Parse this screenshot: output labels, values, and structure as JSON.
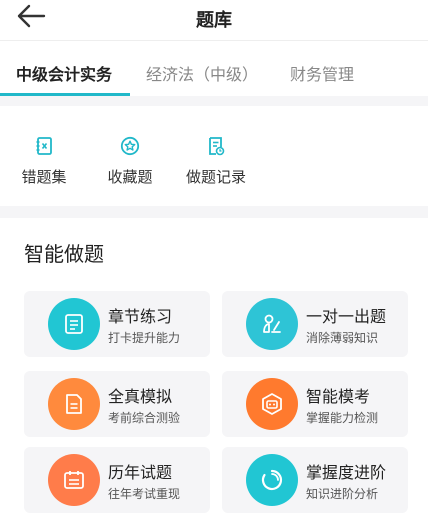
{
  "header": {
    "title": "题库",
    "back_icon": "arrow-left-icon"
  },
  "tabs": [
    {
      "label": "中级会计实务",
      "active": true
    },
    {
      "label": "经济法（中级）",
      "active": false
    },
    {
      "label": "财务管理",
      "active": false
    }
  ],
  "quick": [
    {
      "label": "错题集",
      "icon": "notebook-x-icon"
    },
    {
      "label": "收藏题",
      "icon": "star-circle-icon"
    },
    {
      "label": "做题记录",
      "icon": "record-doc-icon"
    }
  ],
  "smart": {
    "title": "智能做题",
    "cards": [
      {
        "title": "章节练习",
        "subtitle": "打卡提升能力",
        "icon": "chapter-doc-icon",
        "color": "#21c6d3"
      },
      {
        "title": "一对一出题",
        "subtitle": "消除薄弱知识",
        "icon": "person-write-icon",
        "color": "#2ec4d6"
      },
      {
        "title": "全真模拟",
        "subtitle": "考前综合测验",
        "icon": "exam-paper-icon",
        "color": "#ff8a3d"
      },
      {
        "title": "智能模考",
        "subtitle": "掌握能力检测",
        "icon": "smart-exam-icon",
        "color": "#ff7a2e"
      },
      {
        "title": "历年试题",
        "subtitle": "往年考试重现",
        "icon": "calendar-icon",
        "color": "#ff7c4a"
      },
      {
        "title": "掌握度进阶",
        "subtitle": "知识进阶分析",
        "icon": "progress-ring-icon",
        "color": "#21c6d3"
      }
    ]
  },
  "colors": {
    "accent": "#21b8c9",
    "orange": "#ff8a3d"
  }
}
